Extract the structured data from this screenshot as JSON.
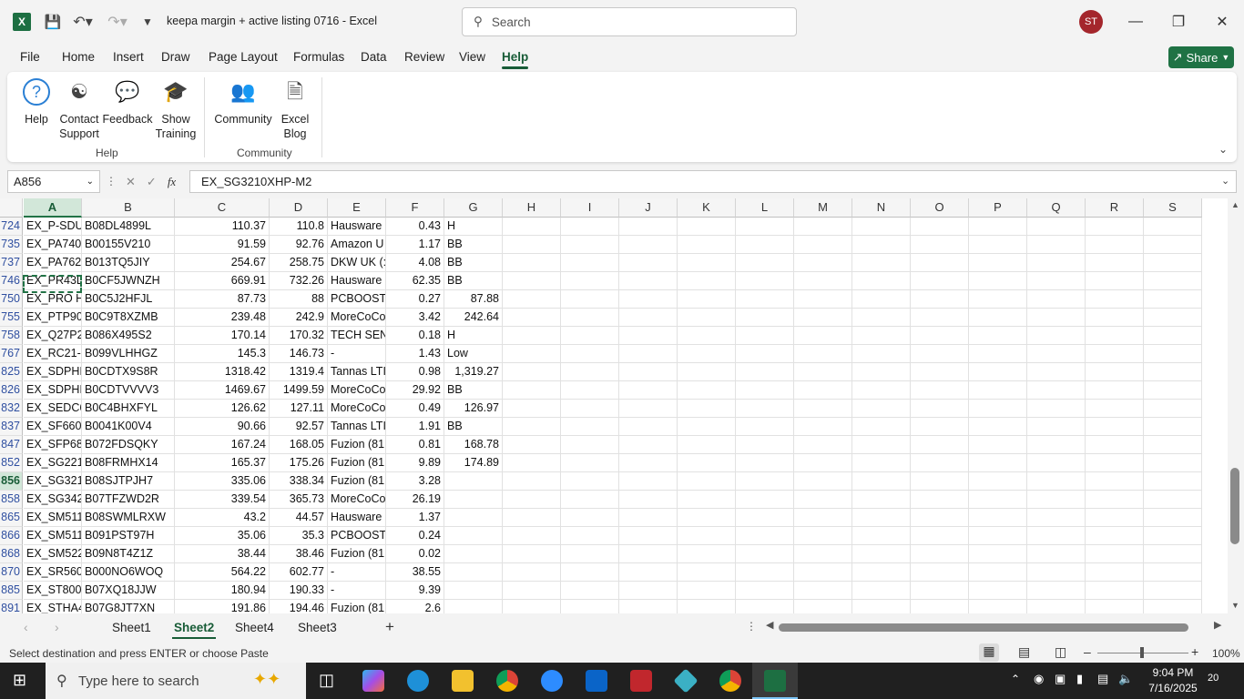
{
  "titlebar": {
    "app_icon": "X",
    "doc_title": "keepa margin + active listing 0716  -  Excel",
    "search_placeholder": "Search",
    "avatar": "ST"
  },
  "menu": [
    "File",
    "Home",
    "Insert",
    "Draw",
    "Page Layout",
    "Formulas",
    "Data",
    "Review",
    "View",
    "Help"
  ],
  "share_label": "Share",
  "ribbon": {
    "help_btn": "Help",
    "contact_l1": "Contact",
    "contact_l2": "Support",
    "feedback": "Feedback",
    "training_l1": "Show",
    "training_l2": "Training",
    "community": "Community",
    "blog_l1": "Excel",
    "blog_l2": "Blog",
    "group_help": "Help",
    "group_community": "Community"
  },
  "formula": {
    "name_box": "A856",
    "fx": "fx",
    "content": "EX_SG3210XHP-M2"
  },
  "columns": [
    "A",
    "B",
    "C",
    "D",
    "E",
    "F",
    "G",
    "H",
    "I",
    "J",
    "K",
    "L",
    "M",
    "N",
    "O",
    "P",
    "Q",
    "R",
    "S"
  ],
  "rows": [
    {
      "n": "724",
      "a": "EX_P-SDU",
      "b": "B08DL4899L",
      "c": "110.37",
      "d": "110.8",
      "e": "Hausware",
      "f": "0.43",
      "g": "H",
      "gnum": false
    },
    {
      "n": "735",
      "a": "EX_PA740",
      "b": "B00155V210",
      "c": "91.59",
      "d": "92.76",
      "e": "Amazon U",
      "f": "1.17",
      "g": "BB",
      "gnum": false
    },
    {
      "n": "737",
      "a": "EX_PA762",
      "b": "B013TQ5JIY",
      "c": "254.67",
      "d": "258.75",
      "e": "DKW UK (:",
      "f": "4.08",
      "g": "BB",
      "gnum": false
    },
    {
      "n": "746",
      "a": "EX_PR43D",
      "b": "B0CF5JWNZH",
      "c": "669.91",
      "d": "732.26",
      "e": "Hausware",
      "f": "62.35",
      "g": "BB",
      "gnum": false
    },
    {
      "n": "750",
      "a": "EX_PRO H",
      "b": "B0C5J2HFJL",
      "c": "87.73",
      "d": "88",
      "e": "PCBOOST",
      "f": "0.27",
      "g": "87.88",
      "gnum": true
    },
    {
      "n": "755",
      "a": "EX_PTP90",
      "b": "B0C9T8XZMB",
      "c": "239.48",
      "d": "242.9",
      "e": "MoreCoCo",
      "f": "3.42",
      "g": "242.64",
      "gnum": true
    },
    {
      "n": "758",
      "a": "EX_Q27P2",
      "b": "B086X495S2",
      "c": "170.14",
      "d": "170.32",
      "e": "TECH SEN:",
      "f": "0.18",
      "g": "H",
      "gnum": false
    },
    {
      "n": "767",
      "a": "EX_RC21-0",
      "b": "B099VLHHGZ",
      "c": "145.3",
      "d": "146.73",
      "e": "-",
      "f": "1.43",
      "g": "Low",
      "gnum": false
    },
    {
      "n": "825",
      "a": "EX_SDPHI",
      "b": "B0CDTX9S8R",
      "c": "1318.42",
      "d": "1319.4",
      "e": "Tannas LTI",
      "f": "0.98",
      "g": "1,319.27",
      "gnum": true
    },
    {
      "n": "826",
      "a": "EX_SDPHI",
      "b": "B0CDTVVVV3",
      "c": "1469.67",
      "d": "1499.59",
      "e": "MoreCoCo",
      "f": "29.92",
      "g": "BB",
      "gnum": false
    },
    {
      "n": "832",
      "a": "EX_SEDC6",
      "b": "B0C4BHXFYL",
      "c": "126.62",
      "d": "127.11",
      "e": "MoreCoCo",
      "f": "0.49",
      "g": "126.97",
      "gnum": true
    },
    {
      "n": "837",
      "a": "EX_SF660",
      "b": "B0041K00V4",
      "c": "90.66",
      "d": "92.57",
      "e": "Tannas LTI",
      "f": "1.91",
      "g": "BB",
      "gnum": false
    },
    {
      "n": "847",
      "a": "EX_SFP68",
      "b": "B072FDSQKY",
      "c": "167.24",
      "d": "168.05",
      "e": "Fuzion (81",
      "f": "0.81",
      "g": "168.78",
      "gnum": true
    },
    {
      "n": "852",
      "a": "EX_SG221",
      "b": "B08FRMHX14",
      "c": "165.37",
      "d": "175.26",
      "e": "Fuzion (81",
      "f": "9.89",
      "g": "174.89",
      "gnum": true
    },
    {
      "n": "856",
      "a": "EX_SG321",
      "b": "B08SJTPJH7",
      "c": "335.06",
      "d": "338.34",
      "e": "Fuzion (81",
      "f": "3.28",
      "g": "",
      "gnum": false
    },
    {
      "n": "858",
      "a": "EX_SG342",
      "b": "B07TFZWD2R",
      "c": "339.54",
      "d": "365.73",
      "e": "MoreCoCo",
      "f": "26.19",
      "g": "",
      "gnum": false
    },
    {
      "n": "865",
      "a": "EX_SM511",
      "b": "B08SWMLRXW",
      "c": "43.2",
      "d": "44.57",
      "e": "Hausware",
      "f": "1.37",
      "g": "",
      "gnum": false
    },
    {
      "n": "866",
      "a": "EX_SM511",
      "b": "B091PST97H",
      "c": "35.06",
      "d": "35.3",
      "e": "PCBOOST",
      "f": "0.24",
      "g": "",
      "gnum": false
    },
    {
      "n": "868",
      "a": "EX_SM522",
      "b": "B09N8T4Z1Z",
      "c": "38.44",
      "d": "38.46",
      "e": "Fuzion (81",
      "f": "0.02",
      "g": "",
      "gnum": false
    },
    {
      "n": "870",
      "a": "EX_SR560",
      "b": "B000NO6WOQ",
      "c": "564.22",
      "d": "602.77",
      "e": "-",
      "f": "38.55",
      "g": "",
      "gnum": false
    },
    {
      "n": "885",
      "a": "EX_ST800",
      "b": "B07XQ18JJW",
      "c": "180.94",
      "d": "190.33",
      "e": "-",
      "f": "9.39",
      "g": "",
      "gnum": false
    },
    {
      "n": "891",
      "a": "EX_STHA4",
      "b": "B07G8JT7XN",
      "c": "191.86",
      "d": "194.46",
      "e": "Fuzion (81",
      "f": "2.6",
      "g": "",
      "gnum": false
    }
  ],
  "sheets": [
    "Sheet1",
    "Sheet2",
    "Sheet4",
    "Sheet3"
  ],
  "status_text": "Select destination and press ENTER or choose Paste",
  "zoom": "100%",
  "taskbar": {
    "search_placeholder": "Type here to search",
    "time": "9:04 PM",
    "date": "7/16/2025",
    "notifications": "20"
  }
}
